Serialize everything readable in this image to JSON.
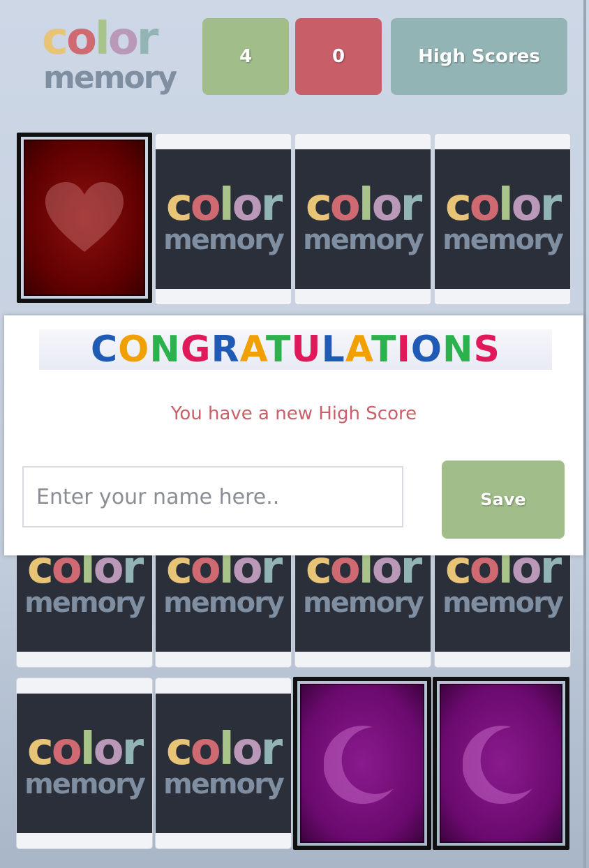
{
  "logo": {
    "line1": "color",
    "line2": "memory"
  },
  "header": {
    "correct_count": "4",
    "wrong_count": "0",
    "high_scores_label": "High Scores"
  },
  "colors": {
    "correct": "#a0bd8a",
    "wrong": "#c75e68",
    "high_scores": "#93b4b4",
    "card_back": "#2b2f39",
    "heart_card": "#6e0606",
    "moon_card": "#6a0a6e",
    "message": "#c96069"
  },
  "board": {
    "rows": [
      [
        "heart-icon",
        "card-back",
        "card-back",
        "card-back"
      ],
      [
        "card-back",
        "card-back",
        "card-back",
        "card-back"
      ],
      [
        "card-back",
        "card-back",
        "card-back",
        "card-back"
      ],
      [
        "card-back",
        "card-back",
        "moon-icon",
        "moon-icon"
      ]
    ]
  },
  "modal": {
    "banner_text": "CONGRATULATIONS",
    "banner_colors": [
      "#1f5bb5",
      "#f0a000",
      "#2bb24c",
      "#e0195a",
      "#1f5bb5",
      "#f0a000",
      "#2bb24c",
      "#e0195a",
      "#1f5bb5",
      "#f0a000",
      "#2bb24c",
      "#e0195a",
      "#1f5bb5",
      "#2bb24c",
      "#e0195a"
    ],
    "message": "You have a new High Score",
    "name_placeholder": "Enter your name here..",
    "save_label": "Save"
  }
}
